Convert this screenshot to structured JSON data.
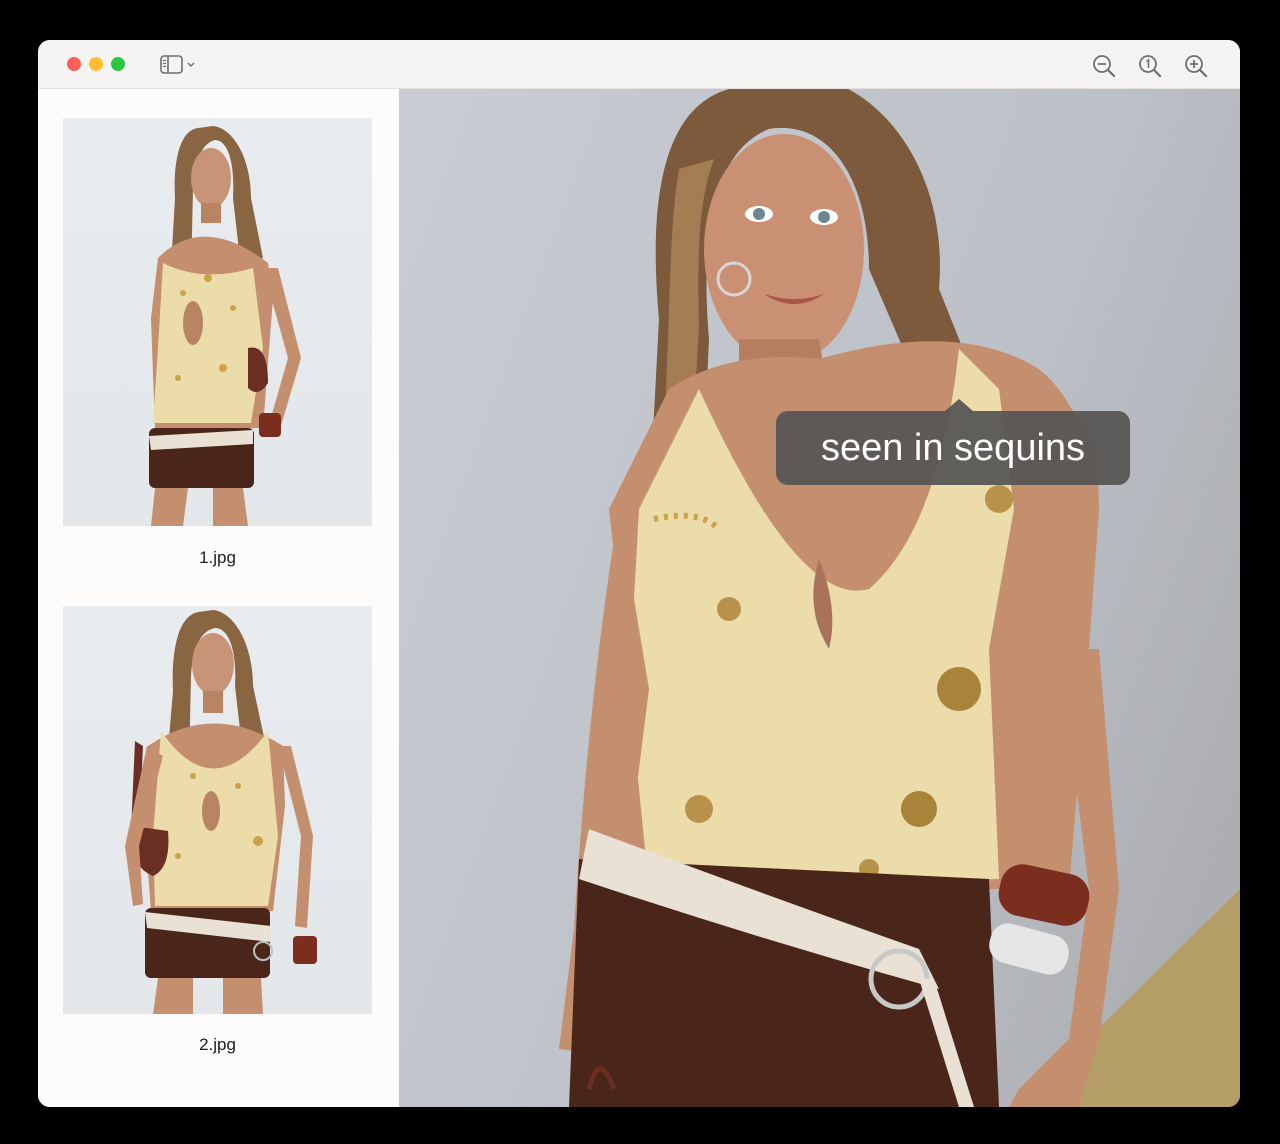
{
  "window": {
    "controls": [
      "close",
      "minimize",
      "maximize"
    ]
  },
  "toolbar": {
    "sidebar_toggle_icon": "sidebar-icon",
    "zoom_out_icon": "zoom-out-icon",
    "actual_size_icon": "actual-size-icon",
    "zoom_in_icon": "zoom-in-icon"
  },
  "sidebar": {
    "items": [
      {
        "label": "1.jpg"
      },
      {
        "label": "2.jpg"
      }
    ]
  },
  "viewer": {
    "tooltip": "seen in sequins"
  },
  "colors": {
    "close": "#fe5f57",
    "minimize": "#febc2e",
    "maximize": "#28c840",
    "tooltip_bg": "#585654"
  }
}
